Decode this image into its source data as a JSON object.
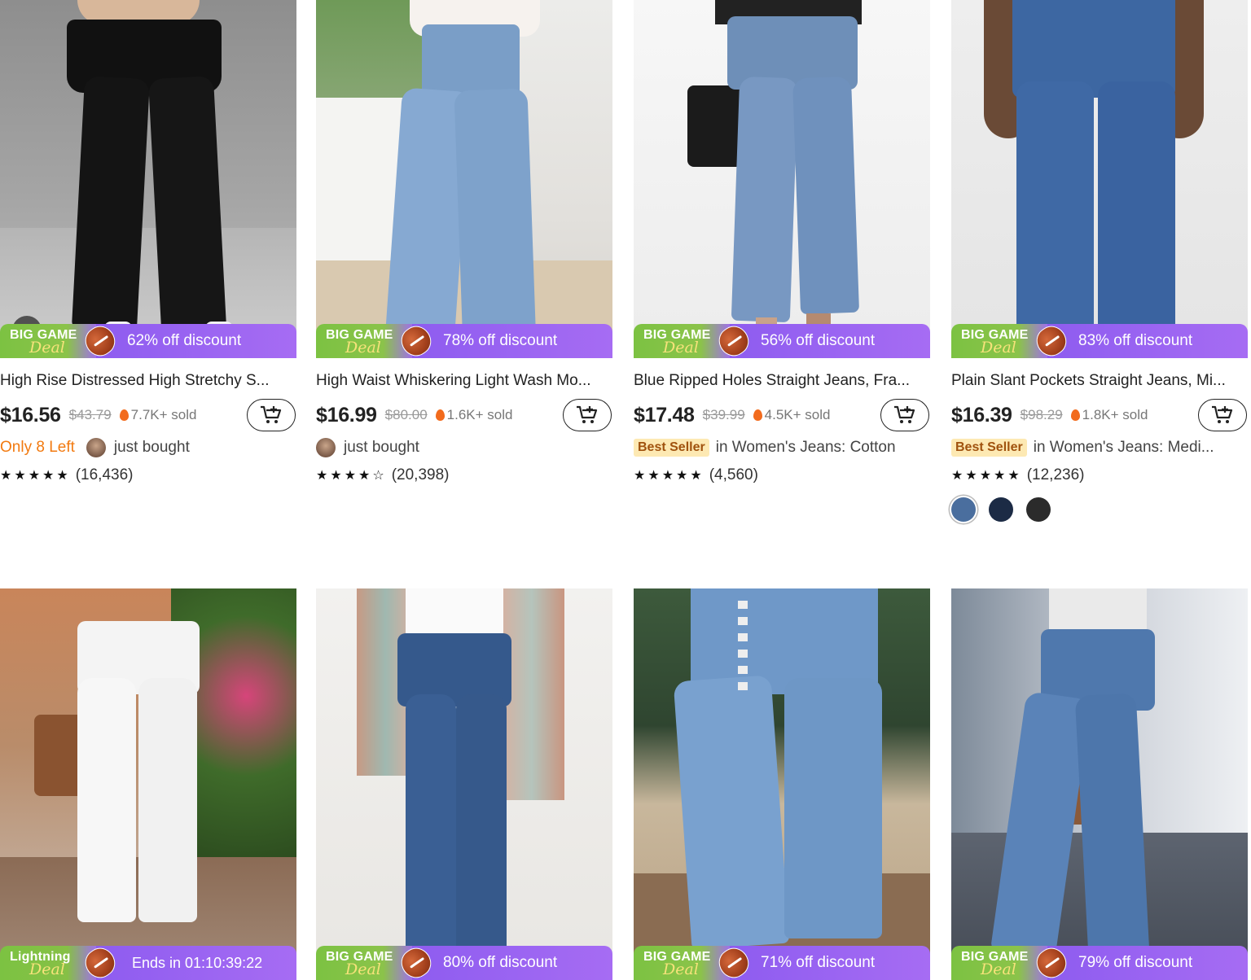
{
  "row1": [
    {
      "title": "High Rise Distressed High Stretchy S...",
      "price": "$16.56",
      "original_price": "$43.79",
      "sold": "7.7K+ sold",
      "discount": "62% off discount",
      "deal_label_top": "BIG GAME",
      "deal_label_script": "Deal",
      "stock_warning": "Only 8 Left",
      "activity": "just bought",
      "stars": "★★★★★",
      "reviews": "(16,436)",
      "has_video": true
    },
    {
      "title": "High Waist Whiskering Light Wash Mo...",
      "price": "$16.99",
      "original_price": "$80.00",
      "sold": "1.6K+ sold",
      "discount": "78% off discount",
      "deal_label_top": "BIG GAME",
      "deal_label_script": "Deal",
      "activity": "just bought",
      "stars": "★★★★☆",
      "reviews": "(20,398)"
    },
    {
      "title": "Blue Ripped Holes Straight Jeans, Fra...",
      "price": "$17.48",
      "original_price": "$39.99",
      "sold": "4.5K+ sold",
      "discount": "56% off discount",
      "deal_label_top": "BIG GAME",
      "deal_label_script": "Deal",
      "badge": "Best Seller",
      "category": "in Women's Jeans: Cotton",
      "stars": "★★★★★",
      "reviews": "(4,560)"
    },
    {
      "title": "Plain Slant Pockets Straight Jeans, Mi...",
      "price": "$16.39",
      "original_price": "$98.29",
      "sold": "1.8K+ sold",
      "discount": "83% off discount",
      "deal_label_top": "BIG GAME",
      "deal_label_script": "Deal",
      "badge": "Best Seller",
      "category": "in Women's Jeans: Medi...",
      "stars": "★★★★★",
      "reviews": "(12,236)",
      "swatch_colors": [
        "#4a6e9e",
        "#1c2b45",
        "#2b2b2b"
      ]
    }
  ],
  "row2": [
    {
      "deal_label_top": "Lightning",
      "deal_label_script": "Deal",
      "discount": "Ends in 01:10:39:22"
    },
    {
      "deal_label_top": "BIG GAME",
      "deal_label_script": "Deal",
      "discount": "80% off discount"
    },
    {
      "deal_label_top": "BIG GAME",
      "deal_label_script": "Deal",
      "discount": "71% off discount"
    },
    {
      "deal_label_top": "BIG GAME",
      "deal_label_script": "Deal",
      "discount": "79% off discount"
    }
  ],
  "colors": {
    "deal_green": "#7cc242",
    "deal_purple": "#a66cf3",
    "warning_orange": "#f27a10",
    "best_seller_bg": "#fde9b3"
  }
}
